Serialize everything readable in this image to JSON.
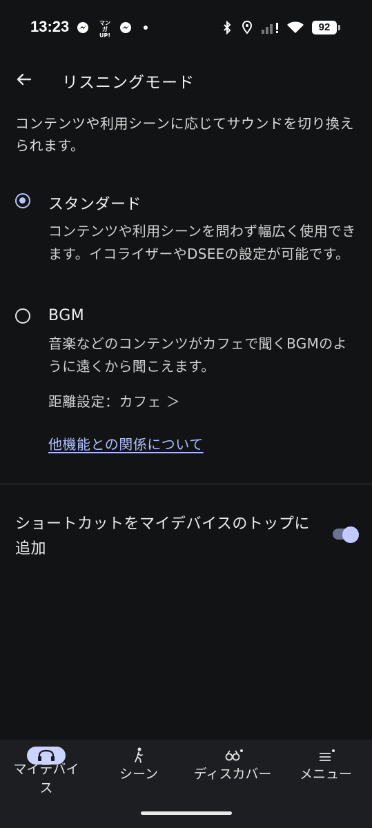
{
  "status_bar": {
    "time": "13:23",
    "manga_badge": "マンガ UP!",
    "battery": "92"
  },
  "header": {
    "back_icon": "arrow-left-icon",
    "title": "リスニングモード"
  },
  "description": "コンテンツや利用シーンに応じてサウンドを切り換えられます。",
  "options": [
    {
      "label": "スタンダード",
      "selected": true,
      "description": "コンテンツや利用シーンを問わず幅広く使用できます。イコライザーやDSEEの設定が可能です。"
    },
    {
      "label": "BGM",
      "selected": false,
      "description": "音楽などのコンテンツがカフェで聞くBGMのように遠くから聞こえます。",
      "distance_setting": "距離設定：カフェ ＞"
    }
  ],
  "relation_link": "他機能との関係について",
  "shortcut": {
    "label": "ショートカットをマイデバイスのトップに追加",
    "enabled": true
  },
  "bottom_nav": [
    {
      "label": "マイデバイス",
      "icon": "headphones-icon",
      "active": true
    },
    {
      "label": "シーン",
      "icon": "walking-person-icon",
      "active": false
    },
    {
      "label": "ディスカバー",
      "icon": "binoculars-icon",
      "active": false
    },
    {
      "label": "メニュー",
      "icon": "menu-icon",
      "active": false
    }
  ],
  "colors": {
    "background": "#111314",
    "accent": "#b9c3ff",
    "link": "#aebcff",
    "nav_background": "#1c1e21"
  }
}
